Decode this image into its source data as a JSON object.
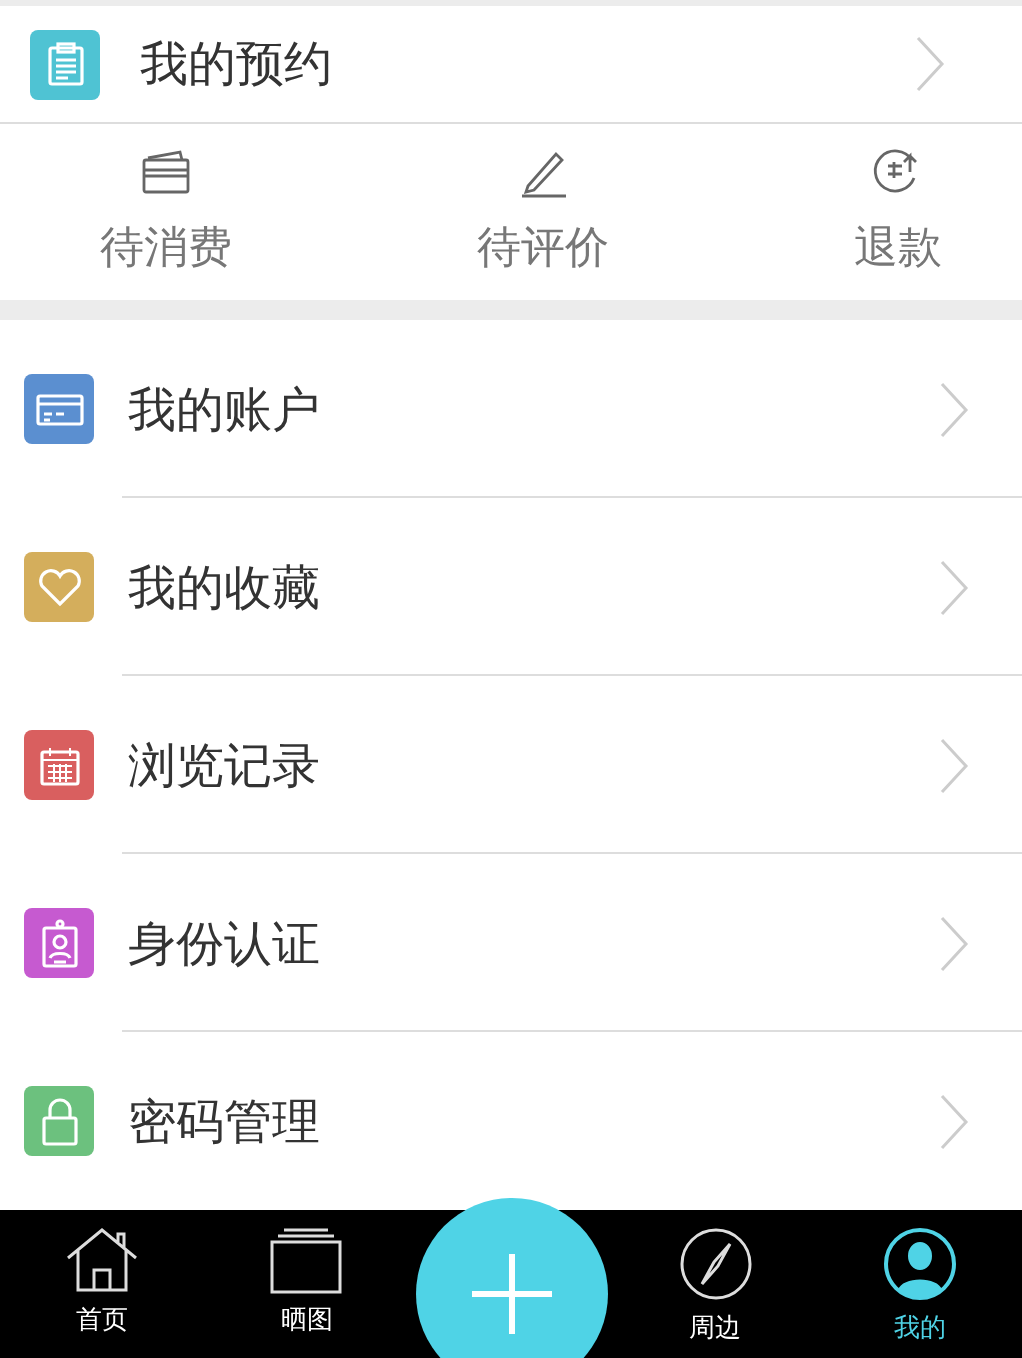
{
  "booking": {
    "label": "我的预约"
  },
  "order_states": [
    {
      "label": "待消费"
    },
    {
      "label": "待评价"
    },
    {
      "label": "退款"
    }
  ],
  "menu": [
    {
      "label": "我的账户",
      "color": "#5b8fd0"
    },
    {
      "label": "我的收藏",
      "color": "#d4ae5c"
    },
    {
      "label": "浏览记录",
      "color": "#d95f5f"
    },
    {
      "label": "身份认证",
      "color": "#c65ad0"
    },
    {
      "label": "密码管理",
      "color": "#6cc17e"
    }
  ],
  "tab_bar": [
    {
      "kind": "tab",
      "label": "首页",
      "selected": false
    },
    {
      "kind": "tab",
      "label": "晒图",
      "selected": false
    },
    {
      "kind": "add"
    },
    {
      "kind": "tab",
      "label": "周边",
      "selected": false
    },
    {
      "kind": "tab",
      "label": "我的",
      "selected": true
    }
  ]
}
